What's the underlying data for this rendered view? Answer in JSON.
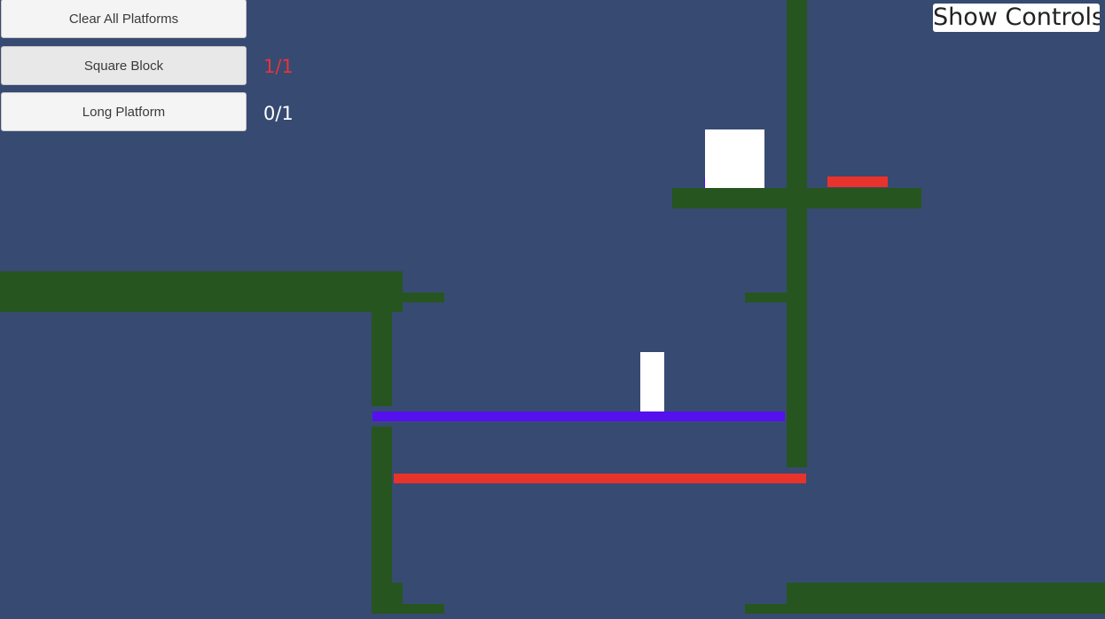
{
  "toolbar": {
    "clear_label": "Clear All Platforms",
    "square_block": {
      "label": "Square Block",
      "count": "1/1",
      "count_color": "#e8333a"
    },
    "long_platform": {
      "label": "Long Platform",
      "count": "0/1",
      "count_color": "#ffffff"
    }
  },
  "show_controls_label": "Show Controls",
  "colors": {
    "background": "#374a72",
    "wall": "#265520",
    "placed_platform": "#5510ee",
    "hazard": "#e8332a",
    "block": "#ffffff"
  }
}
